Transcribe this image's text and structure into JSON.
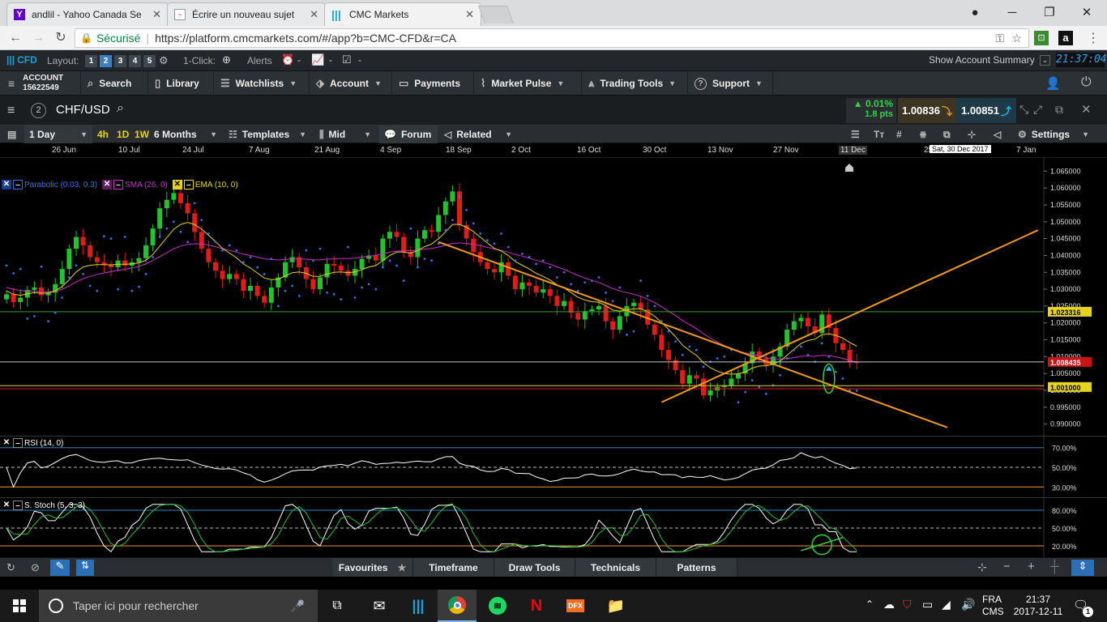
{
  "browser": {
    "tabs": [
      {
        "title": "andlil - Yahoo Canada Se",
        "icon": "yahoo-icon"
      },
      {
        "title": "Écrire un nouveau sujet",
        "icon": "page-icon"
      },
      {
        "title": "CMC Markets",
        "icon": "cmc-icon"
      }
    ],
    "secure_label": "Sécurisé",
    "url": "https://platform.cmcmarkets.com/#/app?b=CMC-CFD&r=CA"
  },
  "topstrip": {
    "brand": "CFD",
    "layout_label": "Layout:",
    "layouts": [
      "1",
      "2",
      "3",
      "4",
      "5"
    ],
    "oneclick_label": "1-Click:",
    "alerts_label": "Alerts",
    "show_summary": "Show Account Summary",
    "clock": "21:37:04"
  },
  "menu": {
    "account_label": "ACCOUNT",
    "account_number": "15622549",
    "items": [
      "Search",
      "Library",
      "Watchlists",
      "Account",
      "Payments",
      "Market Pulse",
      "Trading Tools",
      "Support"
    ]
  },
  "product": {
    "index": "2",
    "symbol": "CHF/USD",
    "change_pct": "0.01%",
    "change_pts": "1.8 pts",
    "sell": "1.00836",
    "buy": "1.00851"
  },
  "chart_toolbar": {
    "period": "1 Day",
    "intervals": [
      "4h",
      "1D",
      "1W"
    ],
    "range": "6 Months",
    "templates": "Templates",
    "price_type": "Mid",
    "forum": "Forum",
    "related": "Related",
    "settings": "Settings"
  },
  "indicators": {
    "parabolic": "Parabolic (0.03, 0.3)",
    "sma": "SMA (26, 0)",
    "ema": "EMA (10, 0)",
    "rsi": "RSI (14, 0)",
    "stoch": "S. Stoch (5, 3, 3)"
  },
  "price_tags": {
    "green": "1.023316",
    "red": "1.008435",
    "yellow": "1.001000"
  },
  "crosshair_date": "Sat, 30 Dec 2017",
  "bottom_tabs": [
    "Favourites",
    "Timeframe",
    "Draw Tools",
    "Technicals",
    "Patterns"
  ],
  "taskbar": {
    "search_placeholder": "Taper ici pour rechercher",
    "lang1": "FRA",
    "lang2": "CMS",
    "time": "21:37",
    "date": "2017-12-11",
    "notif_count": "1"
  },
  "colors": {
    "up": "#22c32e",
    "down": "#e21b1b",
    "sma": "#c832c8",
    "ema": "#e6d31e",
    "psar": "#3a6fe0",
    "trend": "#f09a1e"
  },
  "chart_data": [
    {
      "type": "candlestick",
      "symbol": "CHF/USD",
      "interval": "1 Day",
      "x_ticks": [
        "26 Jun",
        "10 Jul",
        "24 Jul",
        "7 Aug",
        "21 Aug",
        "4 Sep",
        "18 Sep",
        "2 Oct",
        "16 Oct",
        "30 Oct",
        "13 Nov",
        "27 Nov",
        "11 Dec",
        "25 Dec",
        "7 Jan"
      ],
      "y_ticks": [
        "1.065000",
        "1.060000",
        "1.055000",
        "1.050000",
        "1.045000",
        "1.040000",
        "1.035000",
        "1.030000",
        "1.025000",
        "1.020000",
        "1.015000",
        "1.010000",
        "1.005000",
        "1.000000",
        "0.995000",
        "0.990000"
      ],
      "ylim": [
        0.988,
        1.067
      ],
      "grid": false,
      "close": [
        1.0285,
        1.0262,
        1.0275,
        1.0298,
        1.0305,
        1.0282,
        1.029,
        1.0315,
        1.036,
        1.042,
        1.0455,
        1.043,
        1.0395,
        1.038,
        1.0372,
        1.0365,
        1.0385,
        1.037,
        1.038,
        1.0392,
        1.043,
        1.048,
        1.054,
        1.0565,
        1.0585,
        1.0555,
        1.0525,
        1.047,
        1.042,
        1.038,
        1.0355,
        1.033,
        1.0345,
        1.033,
        1.0295,
        1.031,
        1.028,
        1.026,
        1.0305,
        1.0335,
        1.038,
        1.0395,
        1.0365,
        1.033,
        1.03,
        1.0335,
        1.0375,
        1.037,
        1.0355,
        1.034,
        1.036,
        1.039,
        1.04,
        1.0385,
        1.045,
        1.047,
        1.0455,
        1.041,
        1.0395,
        1.045,
        1.0475,
        1.047,
        1.052,
        1.056,
        1.059,
        1.049,
        1.045,
        1.041,
        1.038,
        1.036,
        1.035,
        1.038,
        1.034,
        1.03,
        1.032,
        1.031,
        1.029,
        1.03,
        1.028,
        1.025,
        1.0265,
        1.023,
        1.021,
        1.0235,
        1.024,
        1.025,
        1.0205,
        1.018,
        1.022,
        1.025,
        1.026,
        1.024,
        1.0195,
        1.0165,
        1.012,
        1.009,
        1.006,
        1.002,
        1.0045,
        1.0035,
        0.9985,
        1.0,
        1.001,
        1.0015,
        1.0035,
        1.005,
        1.008,
        1.0115,
        1.0095,
        1.0075,
        1.01,
        1.013,
        1.018,
        1.0205,
        1.0215,
        1.019,
        1.017,
        1.0225,
        1.0185,
        1.014,
        1.012,
        1.0085,
        1.0084
      ],
      "ema_10": [
        1.0295,
        1.0285,
        1.0282,
        1.0286,
        1.029,
        1.0288,
        1.0289,
        1.0295,
        1.0308,
        1.0328,
        1.0351,
        1.0366,
        1.0371,
        1.0373,
        1.0373,
        1.0372,
        1.0374,
        1.0374,
        1.0375,
        1.0378,
        1.0386,
        1.0403,
        1.0428,
        1.0453,
        1.0478,
        1.0492,
        1.0498,
        1.0492,
        1.0478,
        1.046,
        1.0441,
        1.0421,
        1.0407,
        1.0393,
        1.0375,
        1.0363,
        1.0348,
        1.0333,
        1.0328,
        1.033,
        1.0339,
        1.0349,
        1.0351,
        1.0347,
        1.0338,
        1.0338,
        1.0345,
        1.035,
        1.0351,
        1.0349,
        1.0351,
        1.0358,
        1.0366,
        1.037,
        1.0385,
        1.04,
        1.041,
        1.041,
        1.0407,
        1.0415,
        1.0426,
        1.0434,
        1.045,
        1.047,
        1.0492,
        1.0492,
        1.0484,
        1.0471,
        1.0454,
        1.0437,
        1.0421,
        1.0413,
        1.04,
        1.0382,
        1.0371,
        1.036,
        1.0347,
        1.0338,
        1.0327,
        1.0313,
        1.0304,
        1.029,
        1.0276,
        1.0268,
        1.0263,
        1.0261,
        1.0251,
        1.0238,
        1.0235,
        1.0238,
        1.0242,
        1.0242,
        1.0233,
        1.022,
        1.0201,
        1.0181,
        1.0159,
        1.0134,
        1.0118,
        1.0104,
        1.0082,
        1.0067,
        1.0057,
        1.005,
        1.0048,
        1.0049,
        1.0055,
        1.0066,
        1.0072,
        1.0073,
        1.0078,
        1.0087,
        1.0104,
        1.0122,
        1.0139,
        1.0148,
        1.0152,
        1.0165,
        1.0168,
        1.0163,
        1.0155,
        1.0142,
        1.0131
      ],
      "sma_26": [
        1.0305,
        1.03,
        1.0296,
        1.0294,
        1.0294,
        1.0292,
        1.0292,
        1.0294,
        1.03,
        1.031,
        1.0322,
        1.0331,
        1.0338,
        1.0344,
        1.0348,
        1.0352,
        1.0356,
        1.0359,
        1.0363,
        1.0368,
        1.0375,
        1.0385,
        1.0397,
        1.0408,
        1.042,
        1.0428,
        1.0433,
        1.0435,
        1.0434,
        1.0431,
        1.0426,
        1.042,
        1.0415,
        1.041,
        1.0404,
        1.04,
        1.0395,
        1.039,
        1.0388,
        1.0387,
        1.0388,
        1.039,
        1.039,
        1.0389,
        1.0387,
        1.0387,
        1.0389,
        1.039,
        1.0391,
        1.0391,
        1.0392,
        1.0395,
        1.0398,
        1.04,
        1.0405,
        1.041,
        1.0413,
        1.0414,
        1.0414,
        1.0416,
        1.0419,
        1.0421,
        1.0425,
        1.043,
        1.0436,
        1.0437,
        1.0436,
        1.0433,
        1.0429,
        1.0424,
        1.0419,
        1.0415,
        1.041,
        1.0403,
        1.0398,
        1.0392,
        1.0386,
        1.038,
        1.0374,
        1.0366,
        1.0359,
        1.035,
        1.0341,
        1.0333,
        1.0326,
        1.032,
        1.0311,
        1.0302,
        1.0295,
        1.029,
        1.0285,
        1.0279,
        1.027,
        1.026,
        1.0248,
        1.0235,
        1.0222,
        1.0207,
        1.0195,
        1.0183,
        1.0168,
        1.0155,
        1.0143,
        1.0133,
        1.0125,
        1.0117,
        1.0111,
        1.0107,
        1.0102,
        1.0097,
        1.0094,
        1.0093,
        1.0094,
        1.0097,
        1.0101,
        1.0102,
        1.0101,
        1.0104,
        1.0103,
        1.0099,
        1.0095,
        1.0089,
        1.0084
      ]
    },
    {
      "type": "line",
      "name": "RSI (14, 0)",
      "y_ticks": [
        "70.00%",
        "50.00%",
        "30.00%"
      ],
      "ylim": [
        22,
        78
      ],
      "levels": [
        70,
        50,
        30
      ]
    },
    {
      "type": "line",
      "name": "S. Stoch (5, 3, 3)",
      "y_ticks": [
        "80.00%",
        "50.00%",
        "20.00%"
      ],
      "ylim": [
        5,
        95
      ],
      "levels": [
        80,
        50,
        20
      ]
    }
  ]
}
